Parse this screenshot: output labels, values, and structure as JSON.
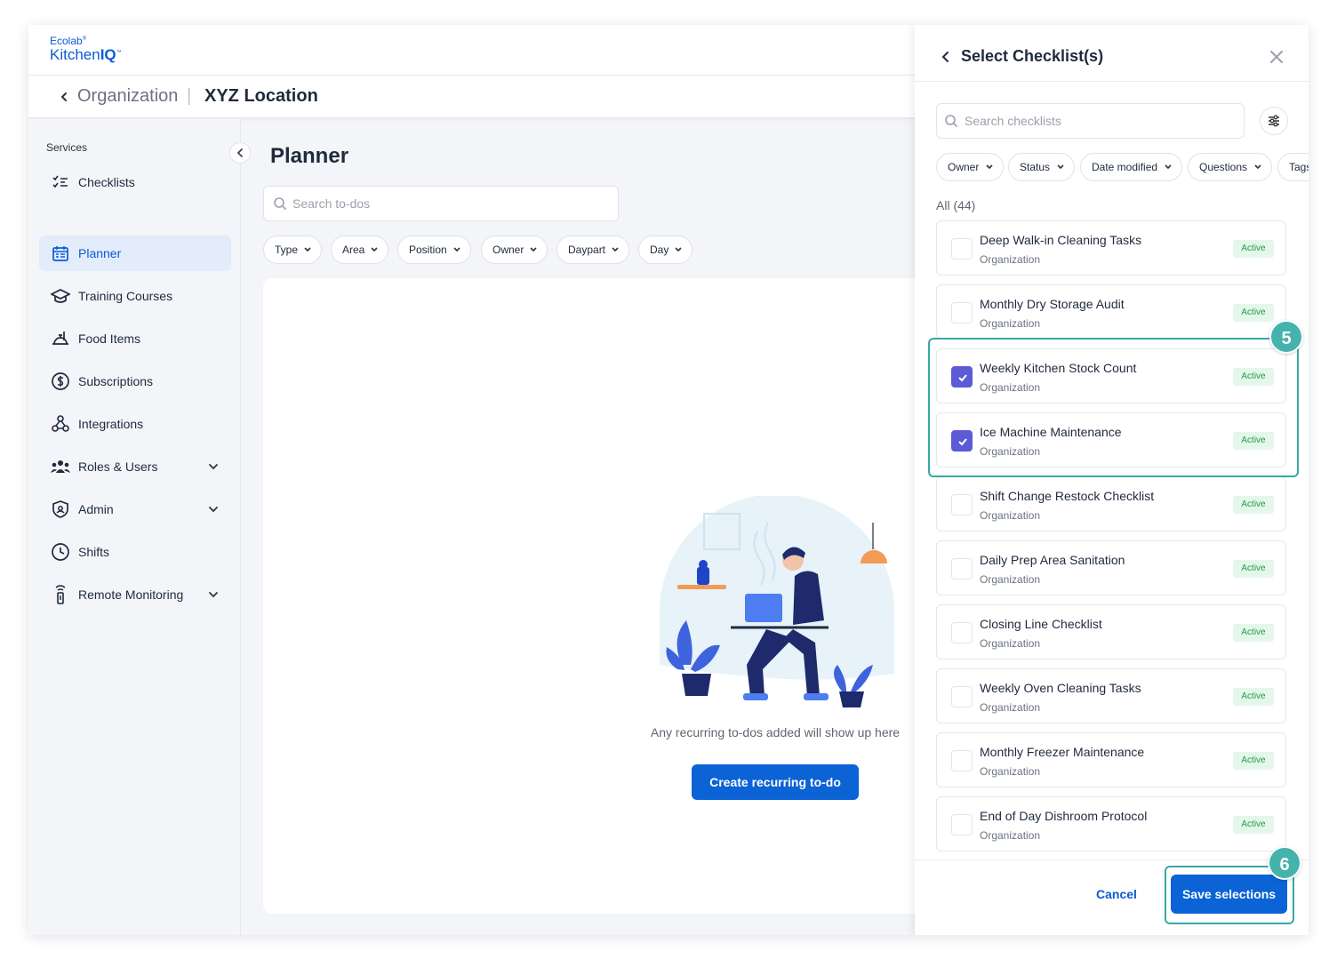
{
  "logo": {
    "line1": "Ecolab",
    "line2a": "Kitchen",
    "line2b": "IQ"
  },
  "breadcrumb": {
    "parent": "Organization",
    "separator": "|",
    "current": "XYZ Location"
  },
  "sidebar": {
    "title": "Services",
    "items": [
      {
        "label": "Checklists",
        "icon": "checklist-icon"
      },
      {
        "label": "Planner",
        "icon": "calendar-icon",
        "active": true
      },
      {
        "label": "Training Courses",
        "icon": "graduation-cap-icon"
      },
      {
        "label": "Food Items",
        "icon": "food-tray-icon"
      },
      {
        "label": "Subscriptions",
        "icon": "dollar-circle-icon"
      },
      {
        "label": "Integrations",
        "icon": "integrations-icon"
      },
      {
        "label": "Roles & Users",
        "icon": "users-icon",
        "expandable": true
      },
      {
        "label": "Admin",
        "icon": "shield-icon",
        "expandable": true
      },
      {
        "label": "Shifts",
        "icon": "clock-icon"
      },
      {
        "label": "Remote Monitoring",
        "icon": "sensor-icon",
        "expandable": true
      }
    ]
  },
  "main": {
    "title": "Planner",
    "search_placeholder": "Search to-dos",
    "filters": [
      "Type",
      "Area",
      "Position",
      "Owner",
      "Daypart",
      "Day"
    ],
    "empty_text": "Any recurring to-dos added will show up here",
    "create_button": "Create recurring to-do"
  },
  "drawer": {
    "title": "Select Checklist(s)",
    "search_placeholder": "Search checklists",
    "filters": [
      "Owner",
      "Status",
      "Date modified",
      "Questions",
      "Tags"
    ],
    "count_label": "All (44)",
    "items": [
      {
        "name": "Deep Walk-in Cleaning Tasks",
        "owner": "Organization",
        "status": "Active",
        "checked": false
      },
      {
        "name": "Monthly Dry Storage Audit",
        "owner": "Organization",
        "status": "Active",
        "checked": false
      },
      {
        "name": "Weekly Kitchen Stock Count",
        "owner": "Organization",
        "status": "Active",
        "checked": true
      },
      {
        "name": "Ice Machine Maintenance",
        "owner": "Organization",
        "status": "Active",
        "checked": true
      },
      {
        "name": "Shift Change Restock Checklist",
        "owner": "Organization",
        "status": "Active",
        "checked": false
      },
      {
        "name": "Daily Prep Area Sanitation",
        "owner": "Organization",
        "status": "Active",
        "checked": false
      },
      {
        "name": "Closing Line Checklist",
        "owner": "Organization",
        "status": "Active",
        "checked": false
      },
      {
        "name": "Weekly Oven Cleaning Tasks",
        "owner": "Organization",
        "status": "Active",
        "checked": false
      },
      {
        "name": "Monthly Freezer Maintenance",
        "owner": "Organization",
        "status": "Active",
        "checked": false
      },
      {
        "name": "End of Day Dishroom Protocol",
        "owner": "Organization",
        "status": "Active",
        "checked": false
      }
    ],
    "cancel_label": "Cancel",
    "save_label": "Save selections"
  },
  "callouts": [
    "5",
    "6"
  ],
  "colors": {
    "brand": "#0b63d6",
    "accent_teal": "#45b3ac",
    "checkbox": "#5b5bd6",
    "badge_green": "#1e9a4d"
  }
}
